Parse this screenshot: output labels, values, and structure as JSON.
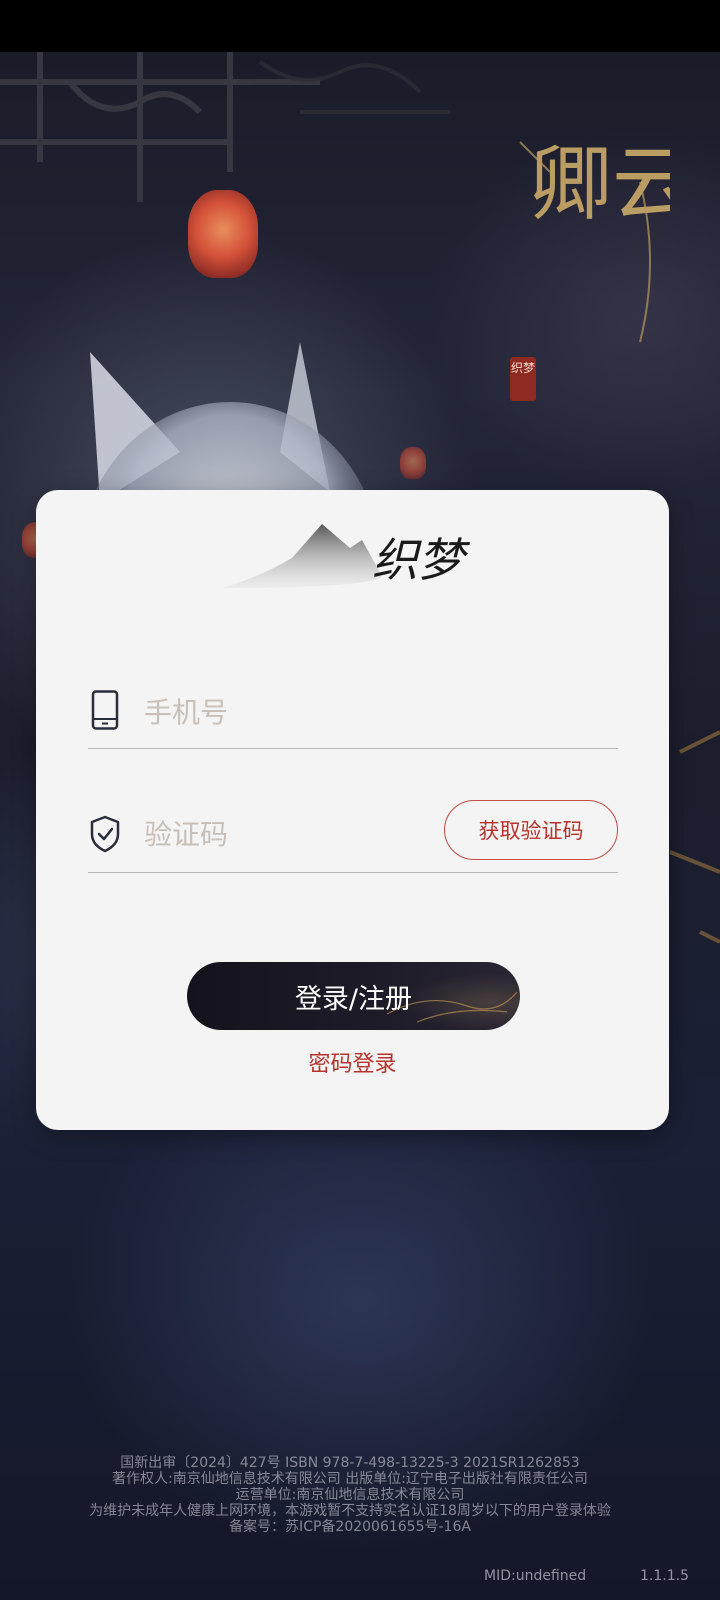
{
  "game": {
    "title": "卿云之上",
    "seal": "织梦"
  },
  "brand": {
    "name": "织梦"
  },
  "login": {
    "phone_placeholder": "手机号",
    "code_placeholder": "验证码",
    "get_code_label": "获取验证码",
    "submit_label": "登录/注册",
    "password_login_label": "密码登录"
  },
  "footer": {
    "lines": [
      "国新出审〔2024〕427号 ISBN 978-7-498-13225-3 2021SR1262853",
      "著作权人:南京仙地信息技术有限公司 出版单位:辽宁电子出版社有限责任公司",
      "运营单位:南京仙地信息技术有限公司",
      "为维护未成年人健康上网环境，本游戏暂不支持实名认证18周岁以下的用户登录体验",
      "备案号：苏ICP备2020061655号-16A"
    ],
    "mid": "MID:undefined",
    "version": "1.1.1.5"
  },
  "colors": {
    "accent": "#b8322c",
    "card_bg": "#f4f4f4",
    "button_bg": "#1d1b28"
  },
  "icons": {
    "phone": "tablet-icon",
    "code": "shield-check-icon"
  }
}
